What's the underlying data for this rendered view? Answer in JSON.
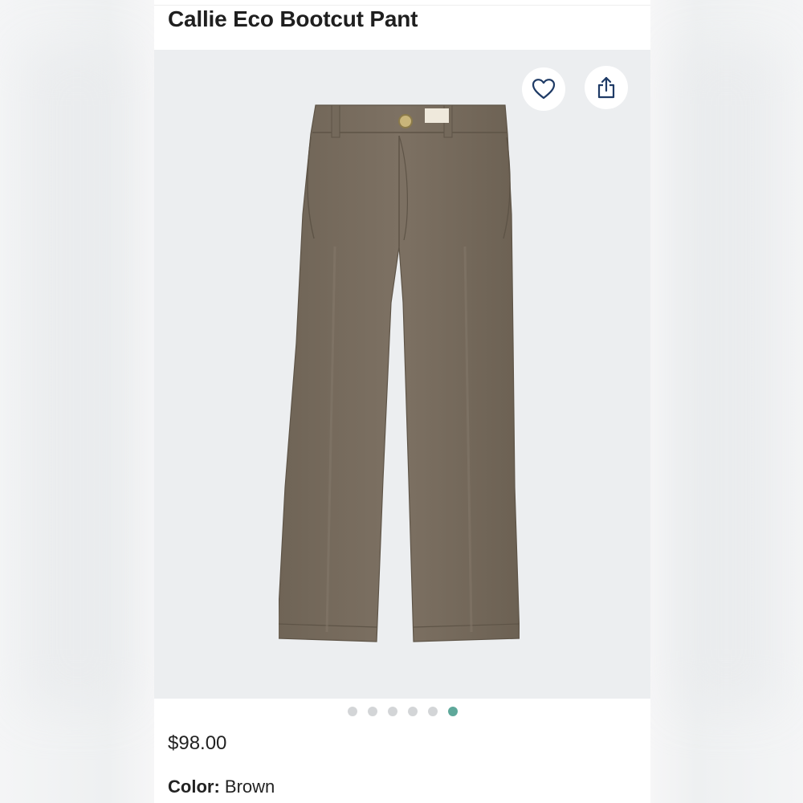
{
  "product": {
    "title": "Callie Eco Bootcut Pant",
    "price": "$98.00",
    "color_label": "Color:",
    "color_value": "Brown"
  },
  "gallery": {
    "image_count": 6,
    "active_index": 5,
    "favorite_icon": "heart-icon",
    "share_icon": "share-icon"
  },
  "colors": {
    "accent": "#5ea89a",
    "dot_inactive": "#d3d5d7",
    "gallery_bg": "#eceef0",
    "pant_color": "#7a6d5e",
    "icon_color": "#1f3b66"
  }
}
